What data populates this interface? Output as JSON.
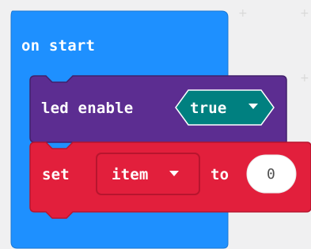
{
  "event_block": {
    "label": "on start",
    "color": "#1e90ff"
  },
  "led_block": {
    "label": "led enable",
    "value": "true",
    "value_dropdown_icon": "caret-down-icon",
    "color": "#5c2d91",
    "shadow_color": "#41206a",
    "value_color": "#008080"
  },
  "set_block": {
    "label": "set",
    "variable": "item",
    "variable_dropdown_icon": "caret-down-icon",
    "to_label": "to",
    "value": "0",
    "color": "#e21f3c",
    "field_border": "#b8152e"
  },
  "workspace": {
    "background": "#f0f0f1",
    "grid_marker": "+"
  }
}
